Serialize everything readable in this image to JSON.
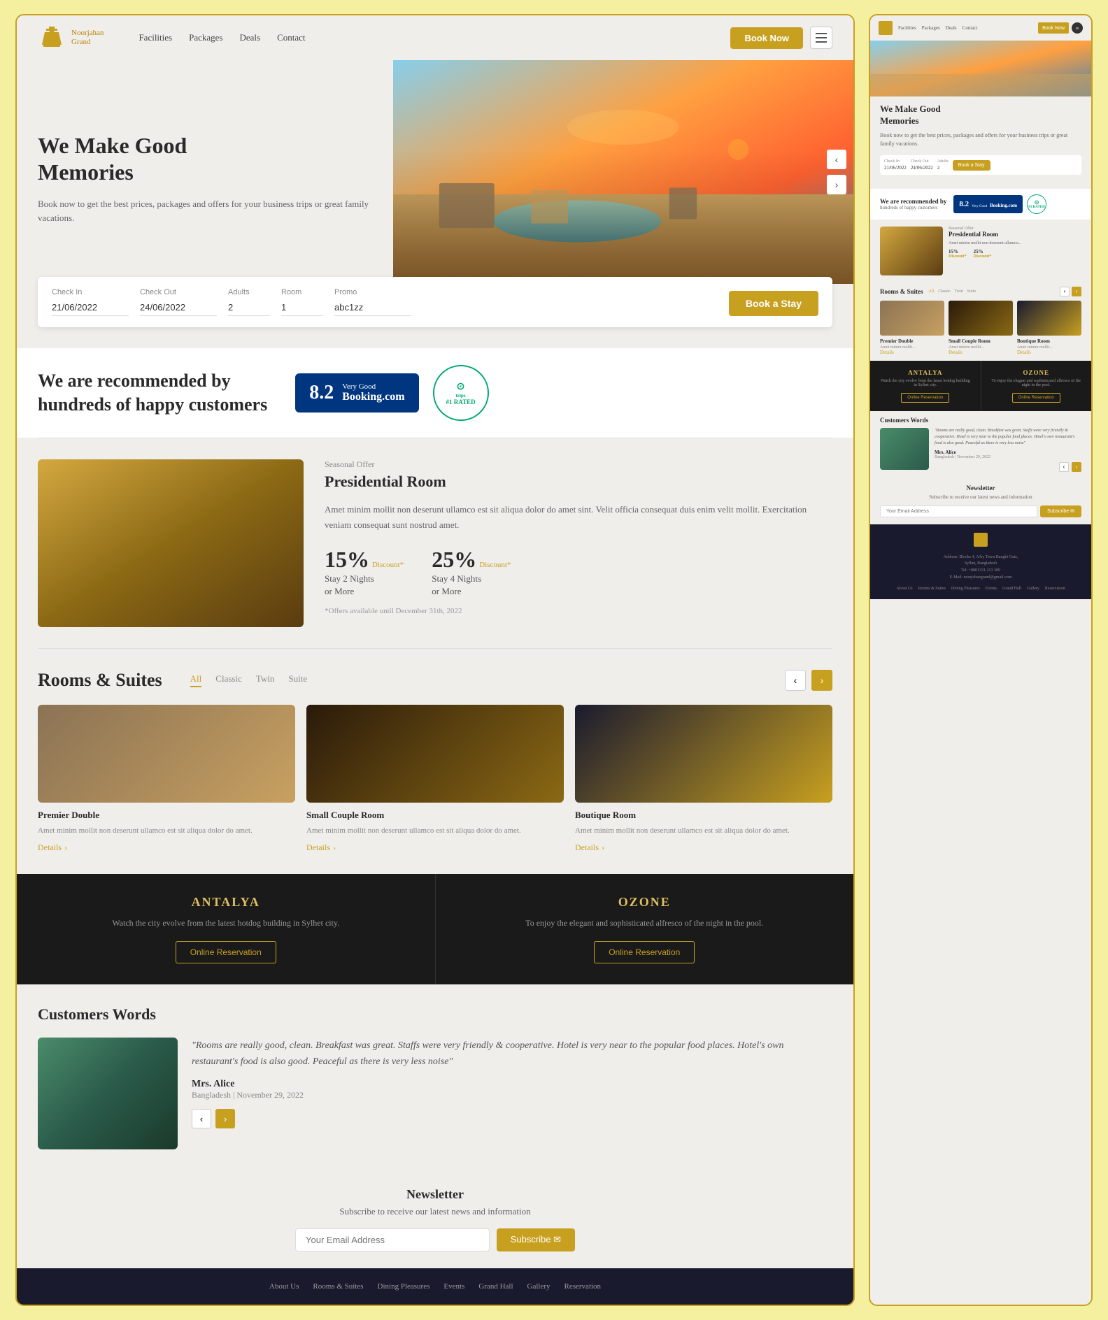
{
  "brand": {
    "name": "Noorjahan",
    "tagline": "Grand",
    "logo_alt": "Noorjahan Grand Hotel Logo"
  },
  "nav": {
    "links": [
      "Facilities",
      "Packages",
      "Deals",
      "Contact"
    ],
    "book_now_label": "Book Now"
  },
  "hero": {
    "headline_line1": "We Make Good",
    "headline_line2": "Memories",
    "description": "Book now to get the best prices, packages and offers for your business trips or great family vacations."
  },
  "booking": {
    "check_in_label": "Check In",
    "check_in_value": "21/06/2022",
    "check_out_label": "Check Out",
    "check_out_value": "24/06/2022",
    "adults_label": "Adults",
    "adults_value": "2",
    "room_label": "Room",
    "room_value": "1",
    "promo_label": "Promo",
    "promo_value": "abc1zz",
    "book_btn": "Book a Stay"
  },
  "recommended": {
    "text_line1": "We are recommended by",
    "text_line2": "hundreds of happy customers",
    "booking_score": "8.2",
    "booking_label": "Very Good",
    "booking_site": "Booking.com",
    "tripadvisor_label": "#1 RATED",
    "tripadvisor_brand": "tripadvisor"
  },
  "seasonal": {
    "tag": "Seasonal Offer",
    "title": "Presidential Room",
    "description": "Amet minim mollit non deserunt ullamco est sit aliqua dolor do amet sint. Velit officia consequat duis enim velit mollit. Exercitation veniam consequat sunt nostrud amet.",
    "discount1_pct": "15%",
    "discount1_label": "Discount*",
    "discount1_stay": "Stay 2 Nights",
    "discount1_or": "or More",
    "discount2_pct": "25%",
    "discount2_label": "Discount*",
    "discount2_stay": "Stay 4 Nights",
    "discount2_or": "or More",
    "note": "*Offers available until December 31th, 2022"
  },
  "rooms": {
    "section_title": "Rooms & Suites",
    "tabs": [
      "All",
      "Classic",
      "Twin",
      "Suite"
    ],
    "active_tab": "All",
    "cards": [
      {
        "name": "Premier Double",
        "description": "Amet minim mollit non deserunt ullamco est sit aliqua dolor do amet.",
        "details_link": "Details"
      },
      {
        "name": "Small Couple Room",
        "description": "Amet minim mollit non deserunt ullamco est sit aliqua dolor do amet.",
        "details_link": "Details"
      },
      {
        "name": "Boutique Room",
        "description": "Amet minim mollit non deserunt ullamco est sit aliqua dolor do amet.",
        "details_link": "Details"
      }
    ]
  },
  "restaurants": [
    {
      "name": "ANTALYA",
      "description": "Watch the city evolve from the latest hotdog building in Sylhet city.",
      "btn_label": "Online Reservation"
    },
    {
      "name": "OZONE",
      "description": "To enjoy the elegant and sophisticated alfresco of the night in the pool.",
      "btn_label": "Online Reservation"
    }
  ],
  "customers": {
    "section_title": "Customers Words",
    "quote": "\"Rooms are really good, clean. Breakfast was great. Staffs were very friendly & cooperative. Hotel is very near to the popular food places. Hotel's own restaurant's food is also good. Peaceful as there is very less noise\"",
    "customer_name": "Mrs. Alice",
    "customer_location": "Bangladesh | November 29, 2022"
  },
  "newsletter": {
    "title": "Newsletter",
    "description": "Subscribe to receive our latest news and information",
    "placeholder": "Your Email Address",
    "subscribe_btn": "Subscribe ✉"
  },
  "footer": {
    "nav_links": [
      "About Us",
      "Rooms & Suites",
      "Dining Pleasures",
      "Events",
      "Grand Hall",
      "Gallery",
      "Reservation"
    ]
  }
}
